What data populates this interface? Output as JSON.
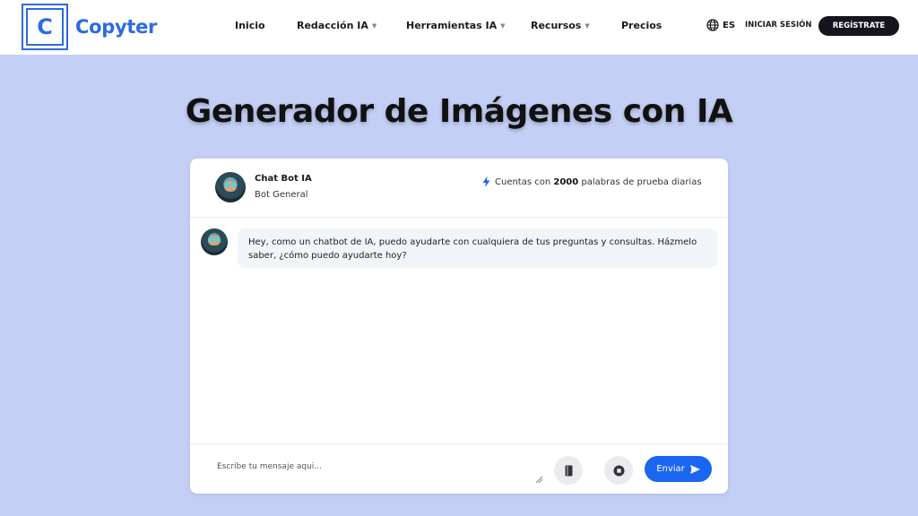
{
  "brand": {
    "letter": "C",
    "name": "Copyter",
    "color": "#2d6ae3"
  },
  "nav": {
    "items": [
      {
        "label": "Inicio",
        "dropdown": false
      },
      {
        "label": "Redacción IA",
        "dropdown": true
      },
      {
        "label": "Herramientas IA",
        "dropdown": true
      },
      {
        "label": "Recursos",
        "dropdown": true
      },
      {
        "label": "Precios",
        "dropdown": false
      }
    ],
    "language": "ES",
    "login": "INICIAR SESIÓN",
    "register": "REGÍSTRATE"
  },
  "page_title": "Generador de Imágenes con IA",
  "chat": {
    "bot_name": "Chat Bot IA",
    "bot_role": "Bot General",
    "trial_prefix": "Cuentas con",
    "trial_count": "2000",
    "trial_suffix": "palabras de prueba diarias",
    "message": "Hey, como un chatbot de IA, puedo ayudarte con cualquiera de tus preguntas y consultas. Házmelo saber, ¿cómo puedo ayudarte hoy?",
    "input_placeholder": "Escribe tu mensaje aqui...",
    "send_label": "Enviar"
  },
  "colors": {
    "background": "#c4cff6",
    "accent": "#1a66f0",
    "dark_button": "#15151f"
  }
}
